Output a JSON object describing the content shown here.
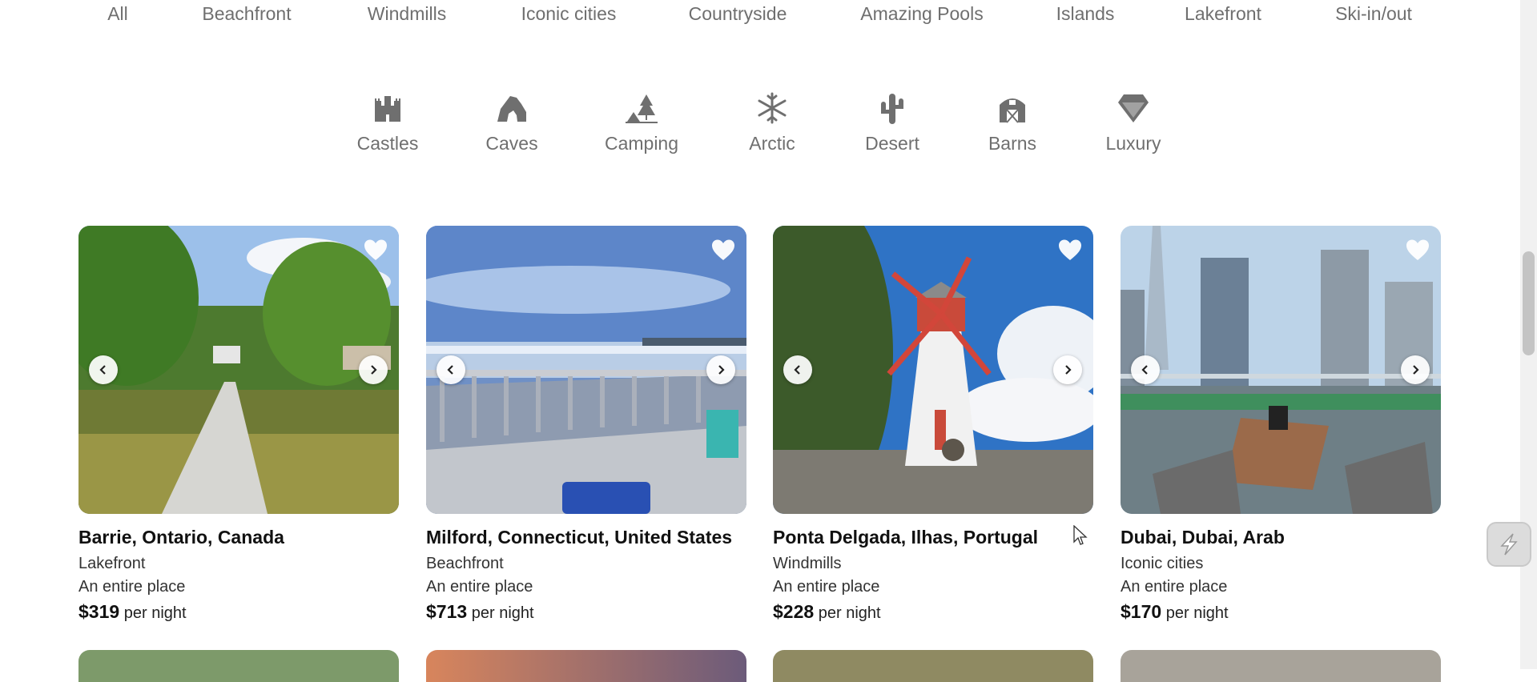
{
  "top_categories": [
    "All",
    "Beachfront",
    "Windmills",
    "Iconic cities",
    "Countryside",
    "Amazing Pools",
    "Islands",
    "Lakefront",
    "Ski-in/out"
  ],
  "icon_categories": [
    {
      "label": "Castles",
      "icon": "castle-icon"
    },
    {
      "label": "Caves",
      "icon": "cave-icon"
    },
    {
      "label": "Camping",
      "icon": "camping-icon"
    },
    {
      "label": "Arctic",
      "icon": "snowflake-icon"
    },
    {
      "label": "Desert",
      "icon": "cactus-icon"
    },
    {
      "label": "Barns",
      "icon": "barn-icon"
    },
    {
      "label": "Luxury",
      "icon": "diamond-icon"
    }
  ],
  "listings": [
    {
      "location": "Barrie, Ontario, Canada",
      "category": "Lakefront",
      "type": "An entire place",
      "price": "$319",
      "per": "per night"
    },
    {
      "location": "Milford, Connecticut, United States",
      "category": "Beachfront",
      "type": "An entire place",
      "price": "$713",
      "per": "per night"
    },
    {
      "location": "Ponta Delgada, Ilhas, Portugal",
      "category": "Windmills",
      "type": "An entire place",
      "price": "$228",
      "per": "per night"
    },
    {
      "location": "Dubai, Dubai, Arab",
      "category": "Iconic cities",
      "type": "An entire place",
      "price": "$170",
      "per": "per night"
    }
  ],
  "colors": {
    "muted_text": "#6f6f6f",
    "heart": "#ffffff",
    "primary_text": "#111111"
  }
}
